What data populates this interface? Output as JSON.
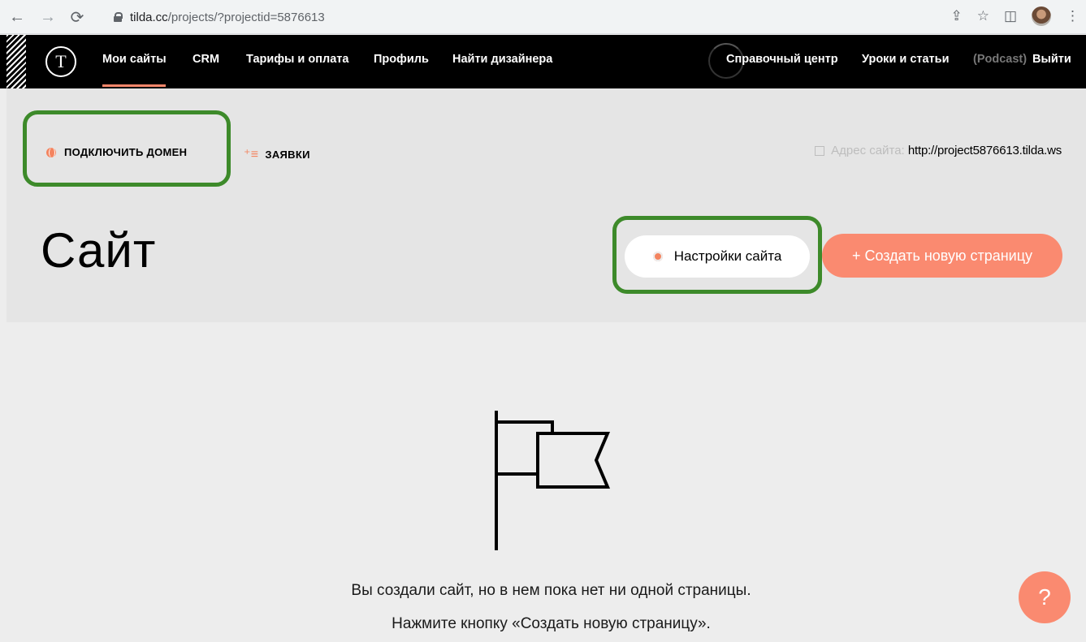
{
  "browser": {
    "url_host": "tilda.cc",
    "url_path": "/projects/?projectid=5876613"
  },
  "topnav": {
    "logo": "T",
    "left_items": [
      "Мои сайты",
      "CRM",
      "Тарифы и оплата",
      "Профиль",
      "Найти дизайнера"
    ],
    "right_items": [
      "Справочный центр",
      "Уроки и статьи"
    ],
    "podcast": "(Podcast)",
    "logout": "Выйти"
  },
  "header": {
    "connect_domain": "ПОДКЛЮЧИТЬ ДОМЕН",
    "leads": "ЗАЯВКИ",
    "site_address_label": "Адрес сайта:",
    "site_address_url": "http://project5876613.tilda.ws",
    "title": "Сайт",
    "settings_button": "Настройки сайта",
    "create_button": "+ Создать новую страницу"
  },
  "empty_state": {
    "line1": "Вы создали сайт, но в нем пока нет ни одной страницы.",
    "line2": "Нажмите кнопку «Создать новую страницу»."
  },
  "help_button": "?",
  "colors": {
    "accent": "#fa8a70",
    "highlight": "#3d8a2a",
    "nav_bg": "#000000"
  }
}
